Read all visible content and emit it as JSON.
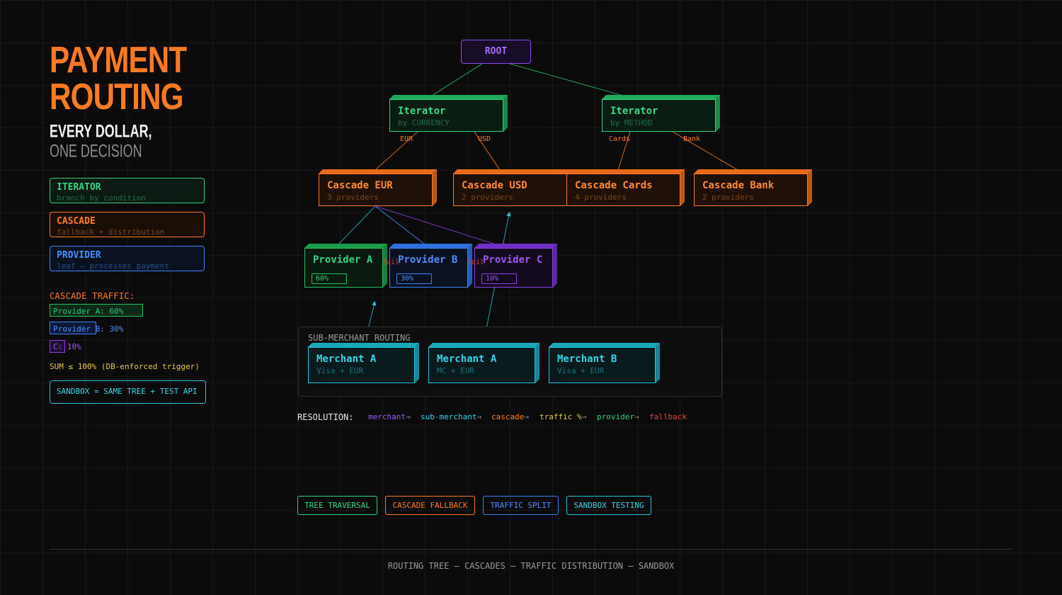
{
  "header": {
    "title_line1": "PAYMENT",
    "title_line2": "ROUTING",
    "subtitle_line1": "EVERY DOLLAR,",
    "subtitle_line2": "ONE DECISION"
  },
  "legend": [
    {
      "title": "ITERATOR",
      "desc": "branch by condition"
    },
    {
      "title": "CASCADE",
      "desc": "fallback + distribution"
    },
    {
      "title": "PROVIDER",
      "desc": "leaf — processes payment"
    }
  ],
  "traffic": {
    "title": "CASCADE TRAFFIC:",
    "bars": [
      {
        "label": "Provider A: 60%",
        "share": 0.6,
        "color": "#22c35e"
      },
      {
        "label": "Provider B: 30%",
        "share": 0.3,
        "color": "#3b82f6"
      },
      {
        "label": "C: 10%",
        "share": 0.1,
        "color": "#8b3fe6"
      }
    ],
    "sum_note": "SUM ≤ 100% (DB-enforced trigger)",
    "sandbox_note": "SANDBOX = SAME TREE + TEST API"
  },
  "tree": {
    "root": "ROOT",
    "iterators": [
      {
        "title": "Iterator",
        "sub": "by CURRENCY",
        "edge_labels": [
          "EUR",
          "USD"
        ]
      },
      {
        "title": "Iterator",
        "sub": "by METHOD",
        "edge_labels": [
          "Cards",
          "Bank"
        ]
      }
    ],
    "cascades": [
      {
        "title": "Cascade EUR",
        "sub": "3 providers"
      },
      {
        "title": "Cascade USD",
        "sub": "2 providers"
      },
      {
        "title": "Cascade Cards",
        "sub": "4 providers"
      },
      {
        "title": "Cascade Bank",
        "sub": "2 providers"
      }
    ],
    "providers": [
      {
        "title": "Provider A",
        "pct": "60%"
      },
      {
        "title": "Provider B",
        "pct": "30%"
      },
      {
        "title": "Provider C",
        "pct": "10%"
      }
    ],
    "fail_label": "fail"
  },
  "sub_merchant": {
    "title": "SUB-MERCHANT ROUTING",
    "merchants": [
      {
        "title": "Merchant A",
        "sub": "Visa + EUR"
      },
      {
        "title": "Merchant A",
        "sub": "MC + EUR"
      },
      {
        "title": "Merchant B",
        "sub": "Visa + EUR"
      }
    ]
  },
  "resolution": {
    "label": "RESOLUTION:",
    "steps": [
      {
        "text": "merchant",
        "color": "#9b57f0"
      },
      {
        "text": "sub-merchant",
        "color": "#3ad2e4"
      },
      {
        "text": "cascade",
        "color": "#ff7a22"
      },
      {
        "text": "traffic %",
        "color": "#e8c64a"
      },
      {
        "text": "provider",
        "color": "#34d27a"
      },
      {
        "text": "fallback",
        "color": "#e0413a"
      }
    ],
    "arrow": "→"
  },
  "tags": [
    {
      "text": "TREE TRAVERSAL",
      "color": "#2ed37a"
    },
    {
      "text": "CASCADE FALLBACK",
      "color": "#ff7a22"
    },
    {
      "text": "TRAFFIC SPLIT",
      "color": "#3b82f6"
    },
    {
      "text": "SANDBOX TESTING",
      "color": "#22c5d8"
    }
  ],
  "footer": "ROUTING TREE — CASCADES — TRAFFIC DISTRIBUTION — SANDBOX"
}
